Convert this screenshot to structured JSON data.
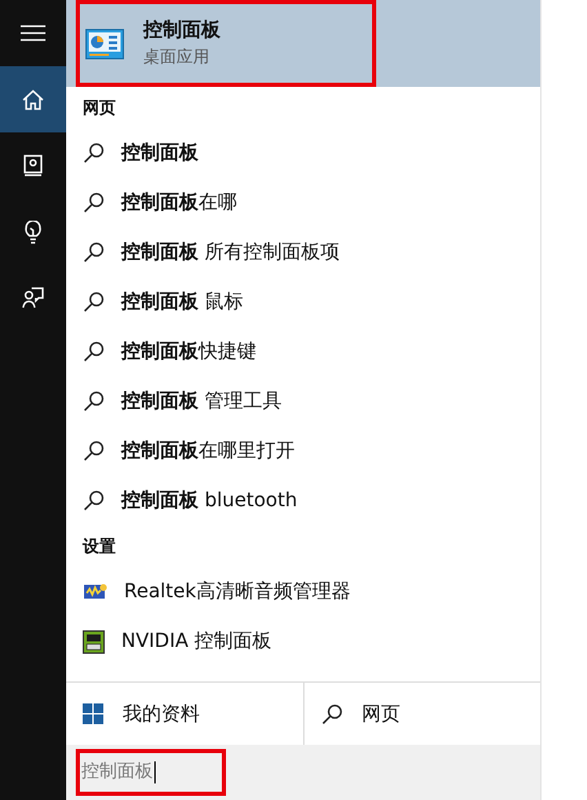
{
  "sidebar": {
    "items": [
      {
        "kind": "menu",
        "selected": false
      },
      {
        "kind": "home",
        "selected": true
      },
      {
        "kind": "notebook",
        "selected": false
      },
      {
        "kind": "bulb",
        "selected": false
      },
      {
        "kind": "feedback",
        "selected": false
      }
    ]
  },
  "best_match": {
    "title": "控制面板",
    "subtitle": "桌面应用"
  },
  "web_section": {
    "heading": "网页",
    "suggestions": [
      "**控制面板**",
      "**控制面板**在哪",
      "**控制面板** 所有控制面板项",
      "**控制面板** 鼠标",
      "**控制面板**快捷键",
      "**控制面板** 管理工具",
      "**控制面板**在哪里打开",
      "**控制面板** bluetooth"
    ]
  },
  "settings_section": {
    "heading": "设置",
    "items": [
      {
        "kind": "realtek",
        "label": "Realtek高清晰音频管理器"
      },
      {
        "kind": "nvidia",
        "label": "NVIDIA 控制面板"
      }
    ]
  },
  "bottom_buttons": [
    {
      "kind": "windows",
      "label": "我的资料"
    },
    {
      "kind": "search",
      "label": "网页"
    }
  ],
  "search_box": {
    "value": "控制面板"
  }
}
